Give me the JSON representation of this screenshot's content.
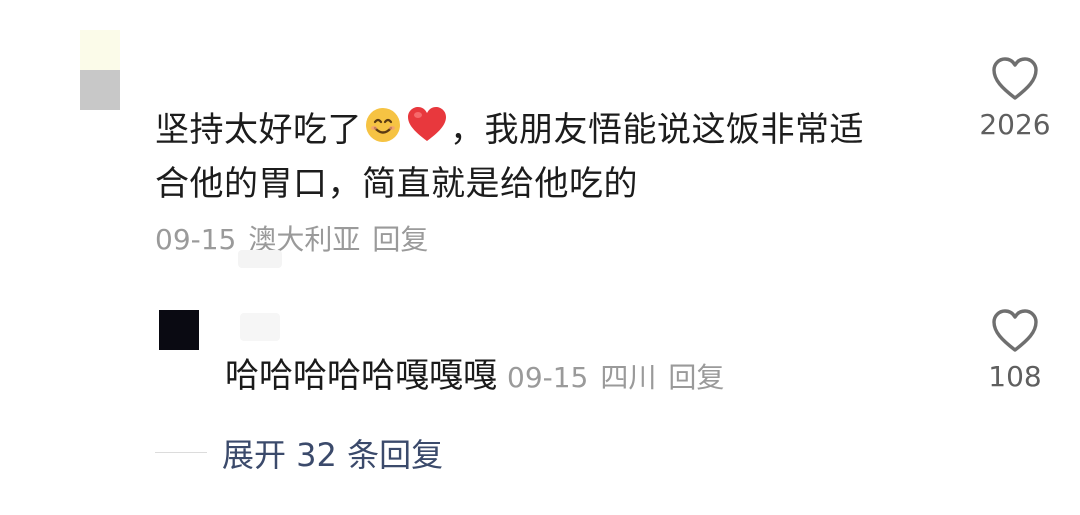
{
  "comment": {
    "text_line1": "坚持太好吃了",
    "text_line1_rest": "，我朋友悟能说这饭非常适",
    "text_line2": "合他的胃口，简直就是给他吃的",
    "date": "09-15",
    "location": "澳大利亚",
    "reply_label": "回复",
    "likes": "2026"
  },
  "reply": {
    "text": "哈哈哈哈哈嘎嘎嘎",
    "date": "09-15",
    "location": "四川",
    "reply_label": "回复",
    "likes": "108"
  },
  "expand": {
    "label": "展开 32 条回复"
  },
  "icons": {
    "like": "heart-outline-icon",
    "smile": "smiling-face-emoji",
    "heart": "red-heart-emoji"
  },
  "colors": {
    "meta": "#9a9a9a",
    "expand": "#3b4a6b",
    "heart_emoji": "#e8383d",
    "smile_emoji": "#f6c343"
  }
}
